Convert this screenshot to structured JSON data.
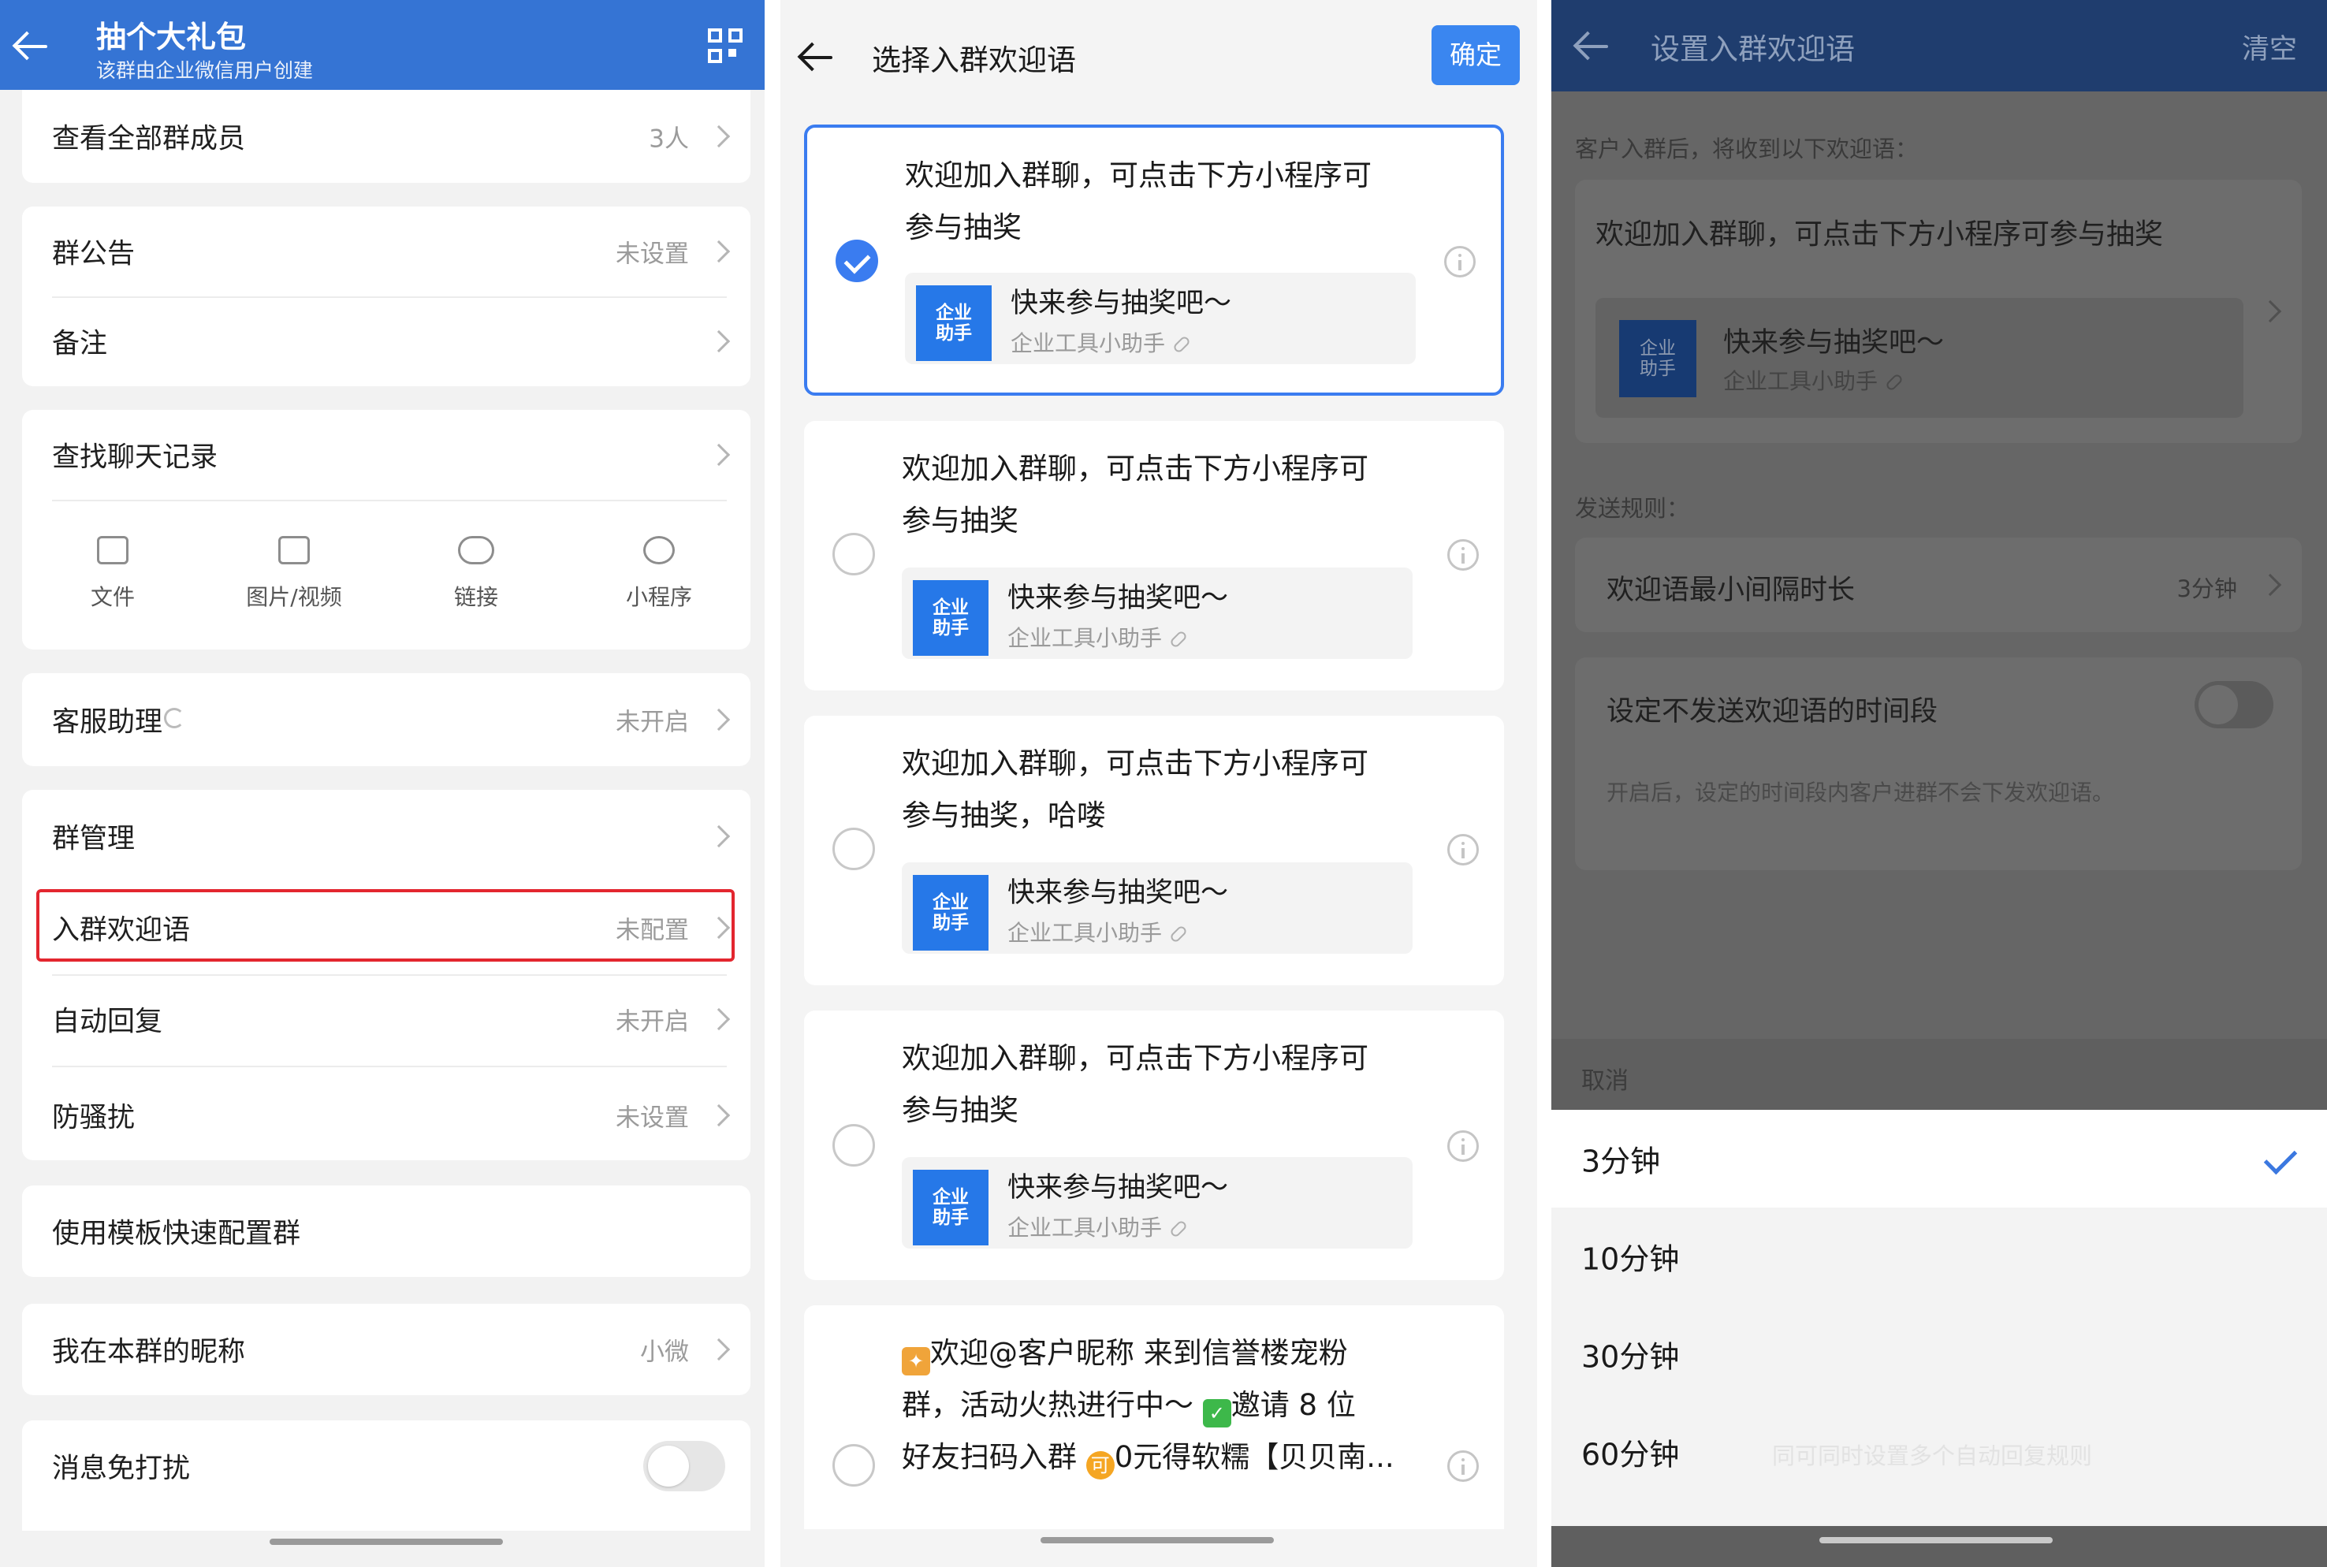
{
  "screen1": {
    "header": {
      "title": "抽个大礼包",
      "subtitle": "该群由企业微信用户创建",
      "icons": [
        "back-arrow-icon",
        "qr-code-icon"
      ]
    },
    "rows": {
      "members": {
        "label": "查看全部群成员",
        "value": "3人"
      },
      "announcement": {
        "label": "群公告",
        "value": "未设置"
      },
      "remark": {
        "label": "备注"
      },
      "search_history": {
        "label": "查找聊天记录"
      },
      "media": [
        {
          "label": "文件",
          "icon": "folder-icon"
        },
        {
          "label": "图片/视频",
          "icon": "image-icon"
        },
        {
          "label": "链接",
          "icon": "link-icon"
        },
        {
          "label": "小程序",
          "icon": "mini-program-icon"
        }
      ],
      "service_assistant": {
        "label": "客服助理",
        "value": "未开启"
      },
      "group_manage": {
        "label": "群管理"
      },
      "welcome": {
        "label": "入群欢迎语",
        "value": "未配置"
      },
      "auto_reply": {
        "label": "自动回复",
        "value": "未开启"
      },
      "anti_harass": {
        "label": "防骚扰",
        "value": "未设置"
      },
      "template": {
        "label": "使用模板快速配置群"
      },
      "nickname": {
        "label": "我在本群的昵称",
        "value": "小微"
      },
      "mute": {
        "label": "消息免打扰",
        "enabled": false
      }
    },
    "accent_color": "#3574d4",
    "highlight_color": "#e3262f"
  },
  "screen2": {
    "header": {
      "title": "选择入群欢迎语",
      "confirm": "确定"
    },
    "options": [
      {
        "line1": "欢迎加入群聊，可点击下方小程序可",
        "line2": "参与抽奖",
        "selected": true
      },
      {
        "line1": "欢迎加入群聊，可点击下方小程序可",
        "line2": "参与抽奖",
        "selected": false
      },
      {
        "line1": "欢迎加入群聊，可点击下方小程序可",
        "line2": "参与抽奖，哈喽",
        "selected": false
      },
      {
        "line1": "欢迎加入群聊，可点击下方小程序可",
        "line2": "参与抽奖",
        "selected": false
      }
    ],
    "option5": {
      "line1": "欢迎@客户昵称 来到信誉楼宠粉",
      "line2a": "群，活动火热进行中～ ",
      "line2b": "邀请 8 位",
      "line3a": "好友扫码入群 ",
      "line3b": "0元得软糯【贝贝南...",
      "badge": "可"
    },
    "mini_program": {
      "logo": "企业\n助手",
      "title": "快来参与抽奖吧～",
      "source": "企业工具小助手"
    },
    "accent_color": "#3a86f0"
  },
  "screen3": {
    "header": {
      "title": "设置入群欢迎语",
      "clear": "清空"
    },
    "hint": "客户入群后，将收到以下欢迎语：",
    "welcome_text": "欢迎加入群聊，可点击下方小程序可参与抽奖",
    "mini_program": {
      "logo": "企业\n助手",
      "title": "快来参与抽奖吧～",
      "source": "企业工具小助手"
    },
    "rules_label": "发送规则：",
    "min_interval": {
      "label": "欢迎语最小间隔时长",
      "value": "3分钟"
    },
    "quiet_period": {
      "label": "设定不发送欢迎语的时间段",
      "enabled": false
    },
    "quiet_note": "开启后，设定的时间段内客户进群不会下发欢迎语。",
    "cancel": "取消",
    "sheet_options": [
      {
        "label": "3分钟",
        "selected": true
      },
      {
        "label": "10分钟",
        "selected": false
      },
      {
        "label": "30分钟",
        "selected": false
      },
      {
        "label": "60分钟",
        "selected": false
      }
    ],
    "ghost_text": "同可同时设置多个自动回复规则"
  }
}
